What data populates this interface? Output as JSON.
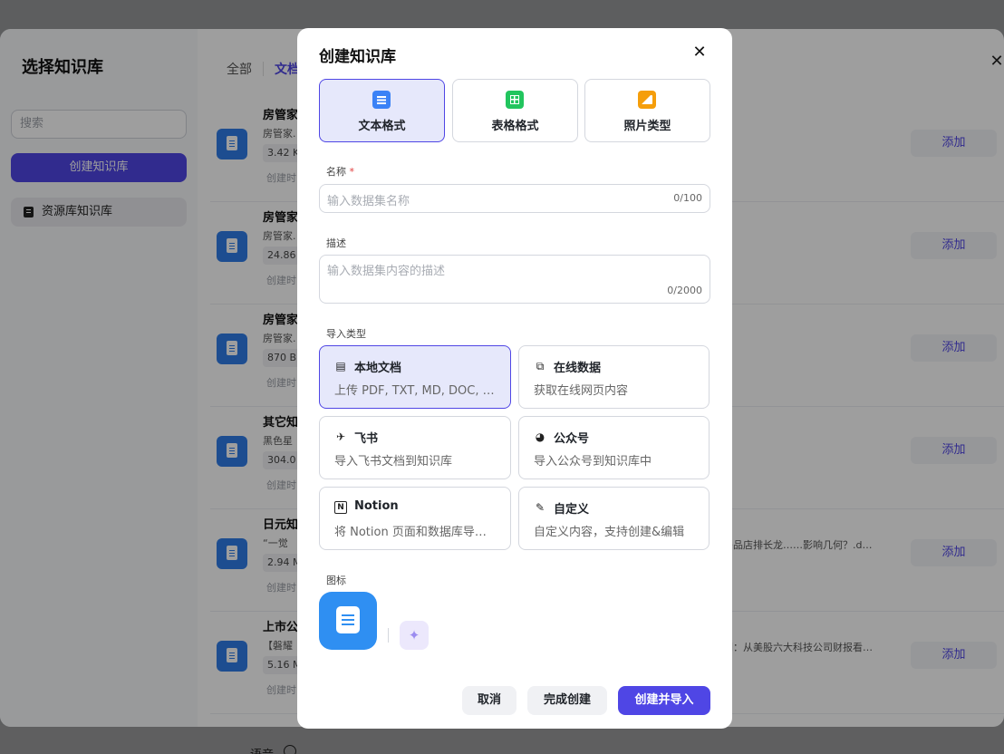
{
  "background": {
    "voice_label": "语音"
  },
  "kb_panel": {
    "title": "选择知识库",
    "search_placeholder": "搜索",
    "create_button": "创建知识库",
    "nav_items": [
      {
        "label": "资源库知识库"
      }
    ],
    "tabs": [
      {
        "label": "全部",
        "active": false
      },
      {
        "label": "文档",
        "active": true
      }
    ],
    "close_icon": "close-icon",
    "add_label": "添加",
    "files": [
      {
        "name": "房管家",
        "desc": "房管家.",
        "desc_right": "",
        "size": "3.42 K",
        "time": "创建时"
      },
      {
        "name": "房管家",
        "desc": "房管家.",
        "desc_right": "",
        "size": "24.86",
        "time": "创建时"
      },
      {
        "name": "房管家",
        "desc": "房管家.",
        "desc_right": "",
        "size": "870 B",
        "time": "创建时"
      },
      {
        "name": "其它知",
        "desc": "黑色星",
        "desc_right": "",
        "size": "304.0",
        "time": "创建时"
      },
      {
        "name": "日元知",
        "desc": "“一觉",
        "desc_right": "多品店排长龙……影响几何？.d…",
        "size": "2.94 M",
        "time": "创建时"
      },
      {
        "name": "上市公",
        "desc": "【磐耀",
        "desc_right": "朗：从美股六大科技公司财报看…",
        "size": "5.16 M",
        "time": "创建时"
      }
    ]
  },
  "modal": {
    "title": "创建知识库",
    "close_icon": "close-icon",
    "formats": [
      {
        "label": "文本格式",
        "icon": "text-doc-icon",
        "selected": true,
        "color": "#3b82f6"
      },
      {
        "label": "表格格式",
        "icon": "table-icon",
        "selected": false,
        "color": "#22c55e"
      },
      {
        "label": "照片类型",
        "icon": "photo-icon",
        "selected": false,
        "color": "#f59e0b"
      }
    ],
    "name": {
      "label": "名称",
      "required_mark": "*",
      "placeholder": "输入数据集名称",
      "count": "0/100"
    },
    "description": {
      "label": "描述",
      "placeholder": "输入数据集内容的描述",
      "count": "0/2000"
    },
    "import_type_label": "导入类型",
    "import_types": [
      {
        "title": "本地文档",
        "desc": "上传 PDF, TXT, MD, DOC, …",
        "icon": "document-icon",
        "glyph": "▤",
        "selected": true
      },
      {
        "title": "在线数据",
        "desc": "获取在线网页内容",
        "icon": "web-page-icon",
        "glyph": "⧉",
        "selected": false
      },
      {
        "title": "飞书",
        "desc": "导入飞书文档到知识库",
        "icon": "feishu-icon",
        "glyph": "✈",
        "selected": false
      },
      {
        "title": "公众号",
        "desc": "导入公众号到知识库中",
        "icon": "wechat-icon",
        "glyph": "◕",
        "selected": false
      },
      {
        "title": "Notion",
        "desc": "将 Notion 页面和数据库导…",
        "icon": "notion-icon",
        "glyph": "N",
        "selected": false
      },
      {
        "title": "自定义",
        "desc": "自定义内容，支持创建&编辑",
        "icon": "custom-edit-icon",
        "glyph": "✎",
        "selected": false
      }
    ],
    "icon_label": "图标",
    "ai_generate_icon": "sparkle-icon",
    "buttons": {
      "cancel": "取消",
      "done": "完成创建",
      "create_import": "创建并导入"
    },
    "accent_color": "#4f46e5"
  }
}
